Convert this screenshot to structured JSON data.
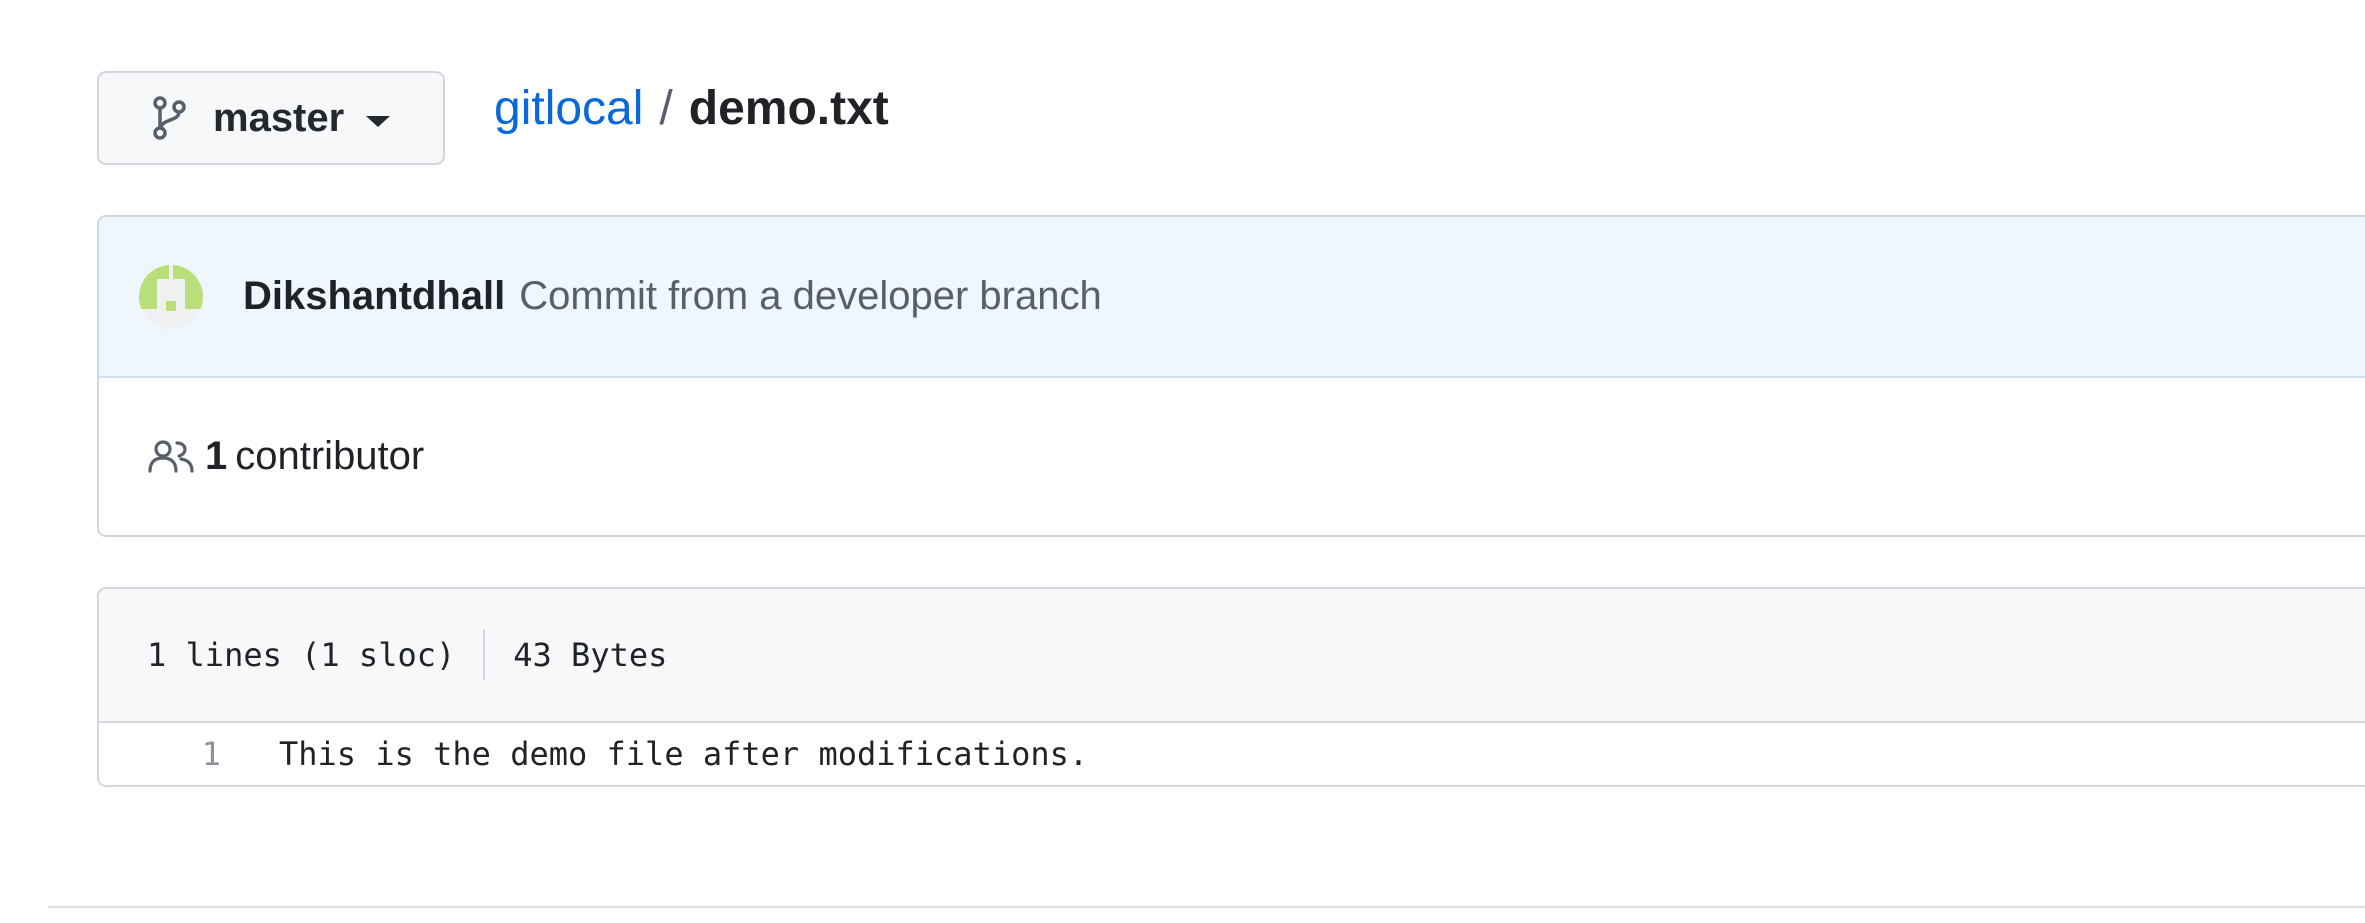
{
  "branch": {
    "icon": "git-branch-icon",
    "name": "master",
    "caret_icon": "triangle-down-icon"
  },
  "breadcrumb": {
    "repo": "gitlocal",
    "separator": "/",
    "file": "demo.txt"
  },
  "commit": {
    "avatar": "identicon-avatar",
    "author": "Dikshantdhall",
    "message": "Commit from a developer branch"
  },
  "contributors": {
    "icon": "people-icon",
    "count": "1",
    "label": "contributor"
  },
  "file": {
    "lines_info": "1 lines (1 sloc)",
    "size": "43 Bytes",
    "lines": [
      {
        "number": "1",
        "text": "This is the demo file after modifications."
      }
    ]
  },
  "colors": {
    "link": "#0969da",
    "commit_bg": "#eff6fe",
    "avatar_green": "#b9df7a",
    "border": "#d0d7de"
  }
}
